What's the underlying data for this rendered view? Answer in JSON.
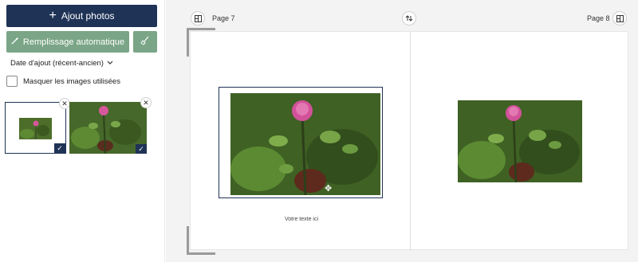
{
  "sidebar": {
    "add_photos_label": "Ajout photos",
    "autofill_label": "Remplissage automatique",
    "sort_label": "Date d'ajout (récent-ancien)",
    "hide_used_label": "Masquer les images utilisées",
    "thumbnails": [
      {
        "selected": true,
        "used": true
      },
      {
        "selected": false,
        "used": true
      }
    ]
  },
  "workspace": {
    "left_page_label": "Page 7",
    "right_page_label": "Page 8",
    "caption_placeholder": "Votre texte ici"
  },
  "colors": {
    "primary": "#1f3356",
    "accent_green": "#7aa586",
    "workspace_bg": "#f3f3f3"
  },
  "icons": [
    "plus-icon",
    "magic-wand-icon",
    "broom-icon",
    "chevron-down-icon",
    "checkmark-icon",
    "close-icon",
    "layout-icon",
    "swap-icon",
    "move-icon"
  ]
}
